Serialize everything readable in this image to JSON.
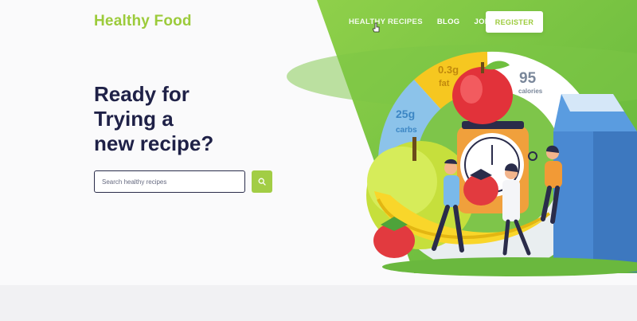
{
  "brand": {
    "name": "Healthy Food",
    "color": "#9ccb3b"
  },
  "nav": {
    "items": [
      {
        "label": "HEALTHY RECIPES"
      },
      {
        "label": "BLOG"
      },
      {
        "label": "JOIN"
      }
    ],
    "register_label": "REGISTER"
  },
  "hero": {
    "headline_line1": "Ready for",
    "headline_line2": "Trying a",
    "headline_line3": "new recipe?"
  },
  "search": {
    "placeholder": "Search healthy recipes"
  },
  "illustration": {
    "fat_value": "0.3g",
    "fat_label": "fat",
    "calories_value": "95",
    "calories_label": "calories",
    "carbs_value": "25g",
    "carbs_label": "carbs"
  },
  "colors": {
    "accent_green": "#9ccb3b",
    "dark_navy": "#1f2147",
    "fat_yellow": "#f6c720",
    "carbs_blue": "#8cc3ea",
    "calories_white": "#ffffff"
  },
  "icons": {
    "search": "search-icon",
    "cursor": "hand-cursor-icon"
  }
}
